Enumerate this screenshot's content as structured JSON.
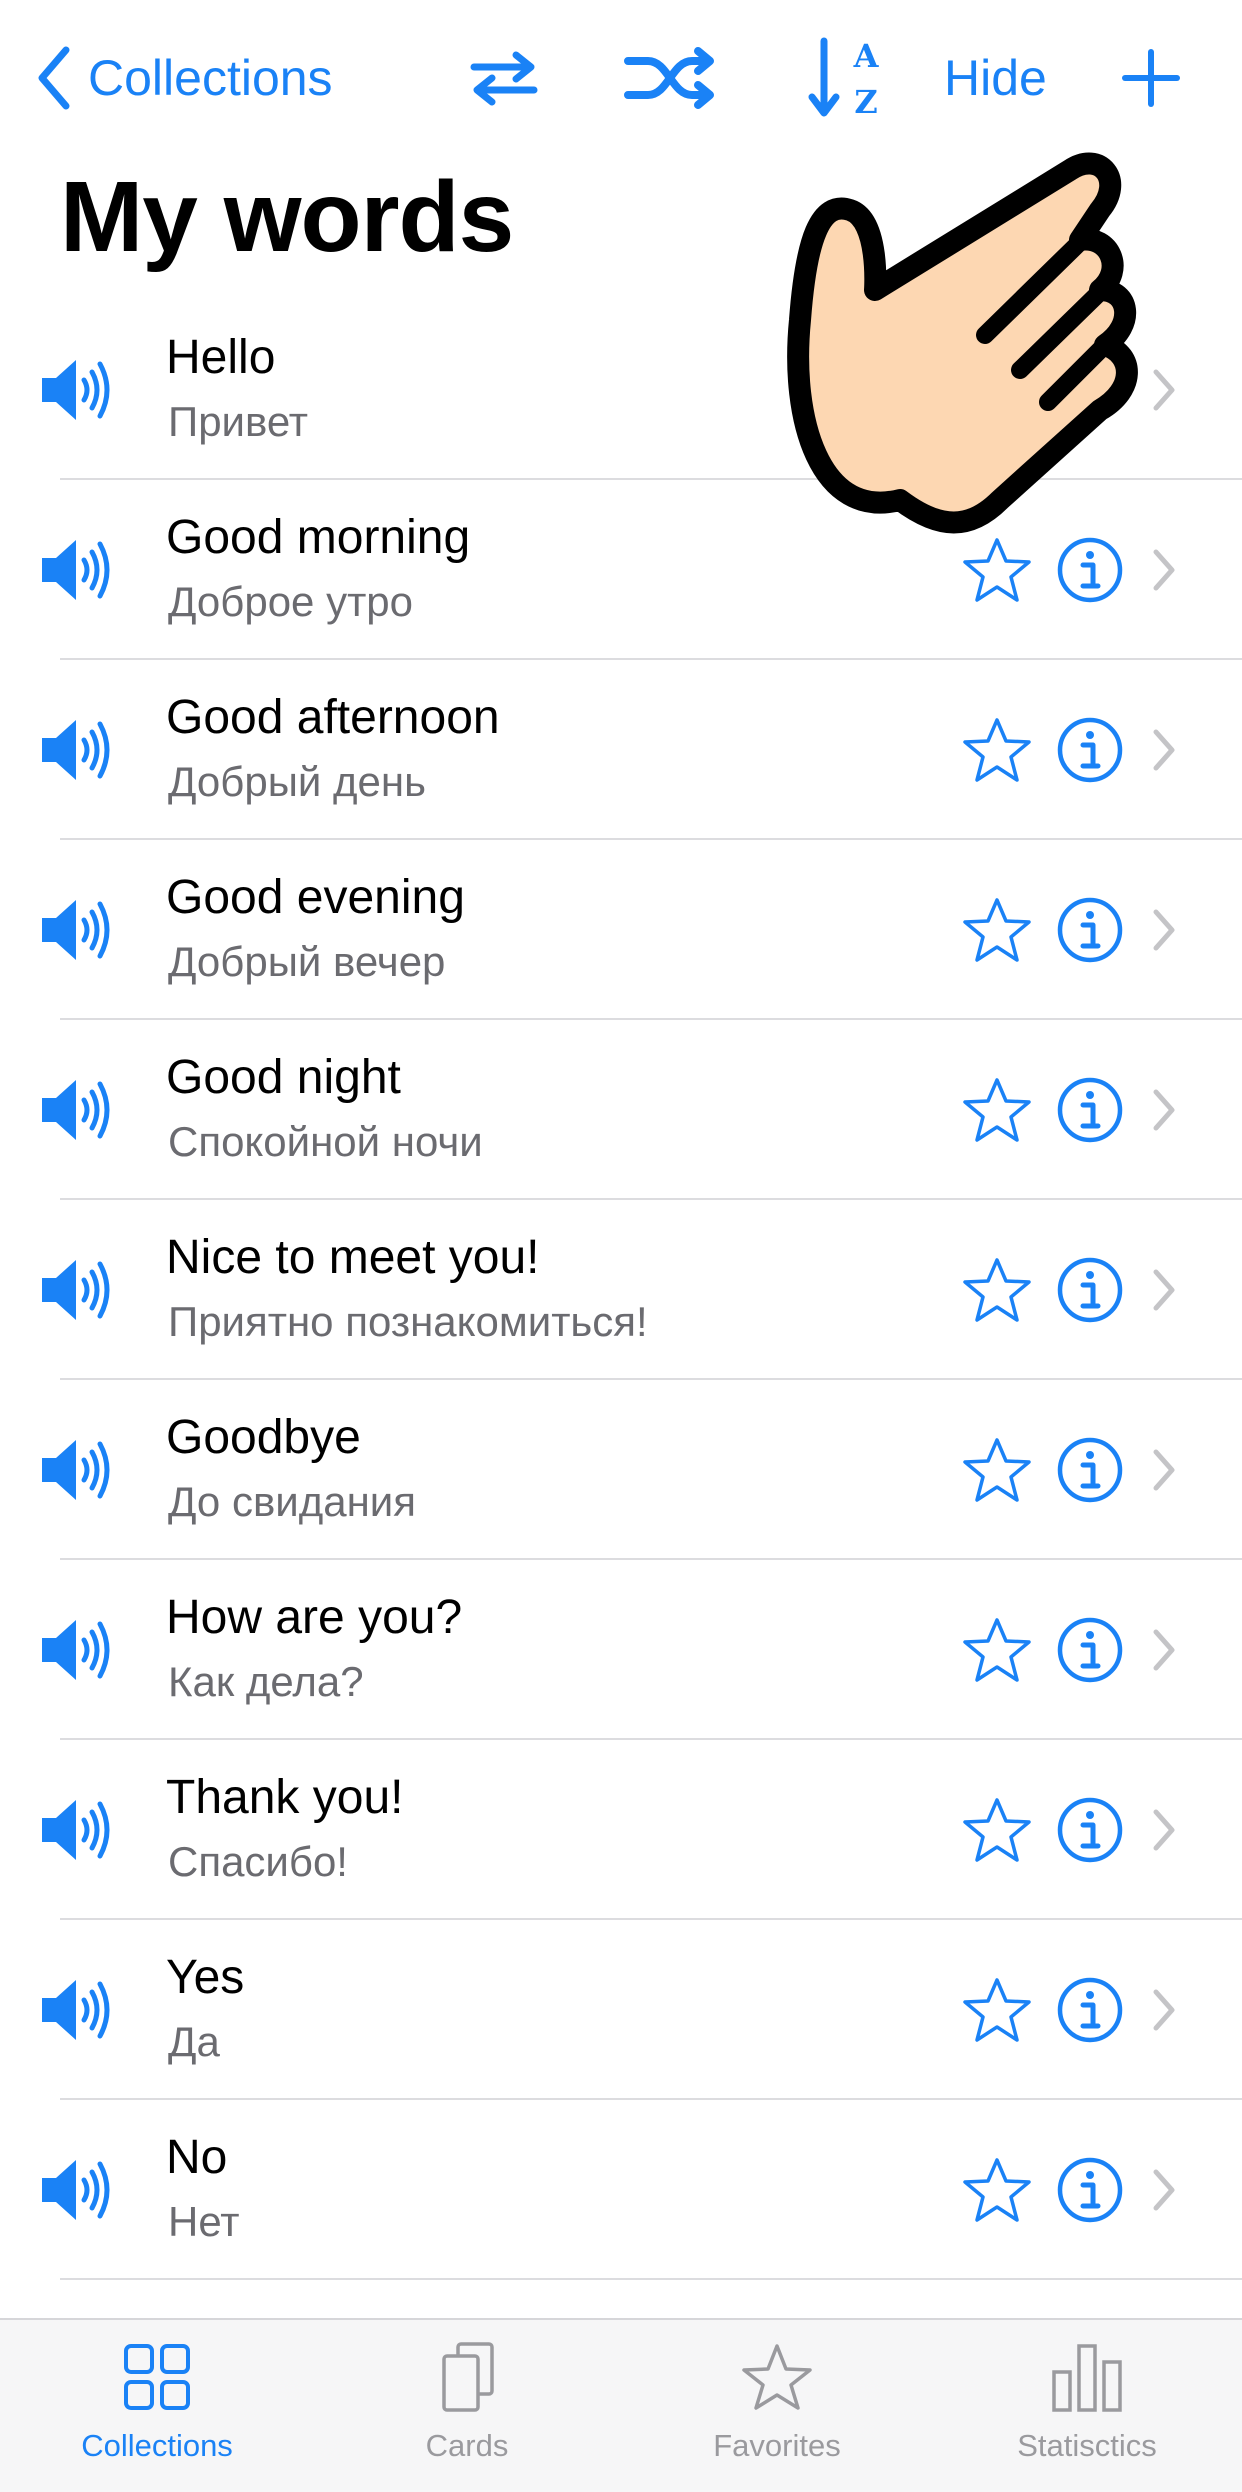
{
  "colors": {
    "accent": "#1a82f6",
    "inactive": "#9a9a9e",
    "separator": "#dcdcdf",
    "hand_fill": "#fdd7b2"
  },
  "nav": {
    "back_label": "Collections",
    "back_icon": "chevron-left-icon",
    "swap_icon": "swap-arrows-icon",
    "shuffle_icon": "shuffle-icon",
    "sort_icon": "sort-az-icon",
    "hide_label": "Hide",
    "add_icon": "plus-icon"
  },
  "title": "My words",
  "words": [
    {
      "word": "Hello",
      "translation": "Привет"
    },
    {
      "word": "Good morning",
      "translation": "Доброе утро"
    },
    {
      "word": "Good afternoon",
      "translation": "Добрый день"
    },
    {
      "word": "Good evening",
      "translation": "Добрый вечер"
    },
    {
      "word": "Good night",
      "translation": "Спокойной ночи"
    },
    {
      "word": "Nice to meet you!",
      "translation": "Приятно познакомиться!"
    },
    {
      "word": "Goodbye",
      "translation": "До свидания"
    },
    {
      "word": "How are you?",
      "translation": "Как дела?"
    },
    {
      "word": "Thank you!",
      "translation": "Спасибо!"
    },
    {
      "word": "Yes",
      "translation": "Да"
    },
    {
      "word": "No",
      "translation": "Нет"
    }
  ],
  "tabs": [
    {
      "label": "Collections",
      "icon": "grid-icon",
      "active": true
    },
    {
      "label": "Cards",
      "icon": "cards-icon",
      "active": false
    },
    {
      "label": "Favorites",
      "icon": "star-icon",
      "active": false
    },
    {
      "label": "Statisctics",
      "icon": "bar-chart-icon",
      "active": false
    }
  ],
  "overlay": {
    "icon": "pointing-hand-icon"
  }
}
